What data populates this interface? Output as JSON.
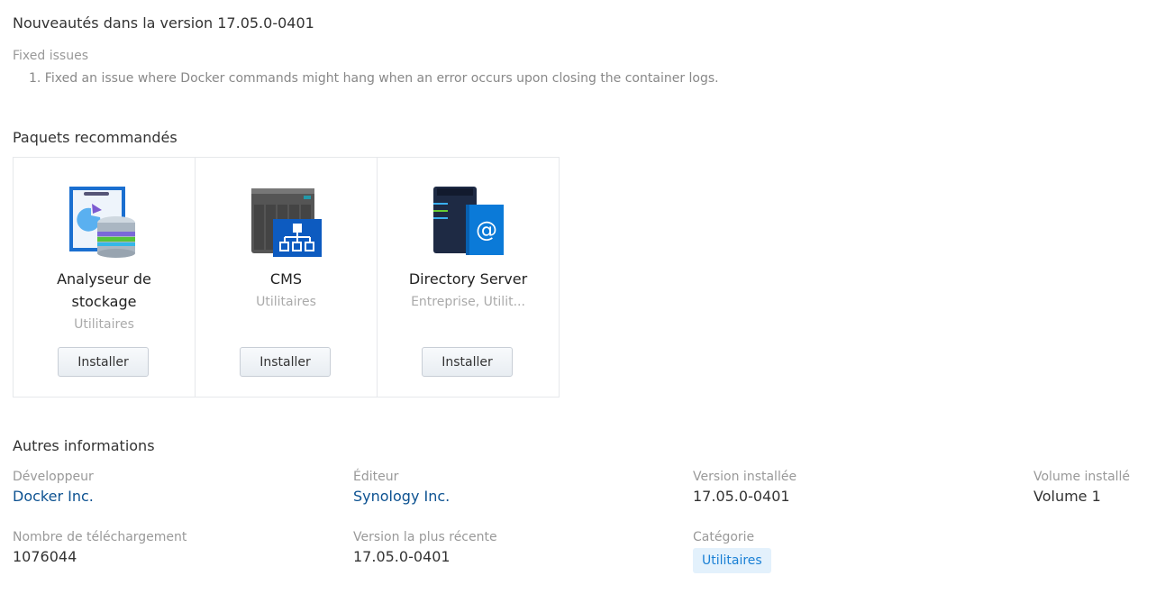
{
  "whatsnew": {
    "title": "Nouveautés dans la version 17.05.0-0401",
    "subtitle": "Fixed issues",
    "items": [
      "1. Fixed an issue where Docker commands might hang when an error occurs upon closing the container logs."
    ]
  },
  "recommended": {
    "title": "Paquets recommandés",
    "packages": [
      {
        "name": "Analyseur de stockage",
        "category": "Utilitaires",
        "button": "Installer",
        "icon": "storage-analyzer-icon"
      },
      {
        "name": "CMS",
        "category": "Utilitaires",
        "button": "Installer",
        "icon": "cms-icon"
      },
      {
        "name": "Directory Server",
        "category": "Entreprise, Utilit...",
        "button": "Installer",
        "icon": "directory-server-icon"
      }
    ]
  },
  "other": {
    "title": "Autres informations",
    "developer_label": "Développeur",
    "developer": "Docker Inc.",
    "publisher_label": "Éditeur",
    "publisher": "Synology Inc.",
    "installed_version_label": "Version installée",
    "installed_version": "17.05.0-0401",
    "volume_label": "Volume installé",
    "volume": "Volume 1",
    "downloads_label": "Nombre de téléchargement",
    "downloads": "1076044",
    "latest_label": "Version la plus récente",
    "latest": "17.05.0-0401",
    "category_label": "Catégorie",
    "category": "Utilitaires"
  }
}
